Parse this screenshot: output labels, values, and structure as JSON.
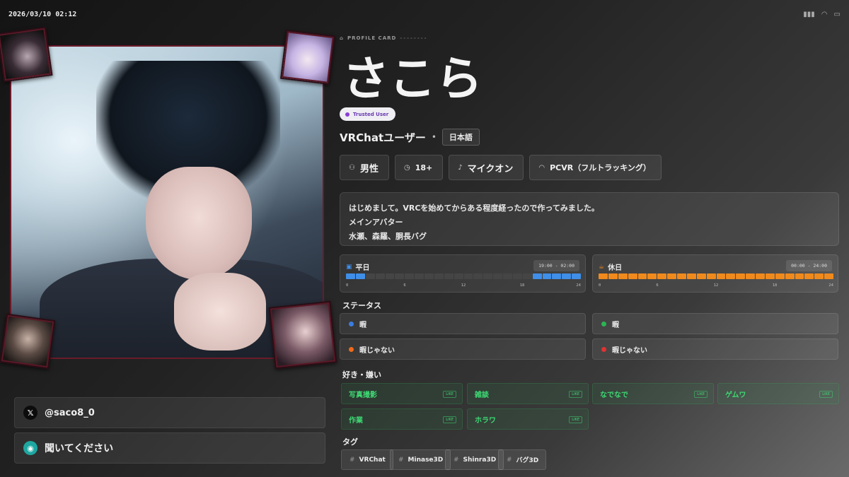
{
  "status_bar": {
    "clock": "2026/03/10 02:12",
    "icons": [
      "signal-icon",
      "wifi-icon",
      "battery-icon"
    ]
  },
  "profile": {
    "eyebrow": "PROFILE CARD",
    "eyebrow_dash": "--------",
    "name": "さこら",
    "trust_badge": "Trusted User",
    "trust_color": "#8a3fd6",
    "subtitle": "VRChatユーザー",
    "language": "日本語"
  },
  "attributes": [
    {
      "icon": "person-icon",
      "label": "男性"
    },
    {
      "icon": "age-icon",
      "label": "18+"
    },
    {
      "icon": "mic-icon",
      "label": "マイクオン"
    },
    {
      "icon": "headset-icon",
      "label": "PCVR（フルトラッキング）"
    }
  ],
  "bio": {
    "lines": [
      "はじめまして。VRCを始めてからある程度経ったので作ってみました。",
      "メインアバター",
      "水瀬、森羅、胴長バグ"
    ]
  },
  "schedule": {
    "weekday": {
      "label": "平日",
      "time": "19:00 - 02:00",
      "color": "#3f8ee8",
      "active_hours": [
        0,
        1,
        19,
        20,
        21,
        22,
        23
      ]
    },
    "holiday": {
      "label": "休日",
      "time": "00:00 - 24:00",
      "color": "#f08a1c",
      "active_hours": [
        0,
        1,
        2,
        3,
        4,
        5,
        6,
        7,
        8,
        9,
        10,
        11,
        12,
        13,
        14,
        15,
        16,
        17,
        18,
        19,
        20,
        21,
        22,
        23
      ]
    },
    "ticks": [
      "0",
      "6",
      "12",
      "18",
      "24"
    ]
  },
  "sections": {
    "status": "ステータス",
    "likes": "好き・嫌い",
    "tags": "タグ"
  },
  "statuses": [
    {
      "label": "暇",
      "color": "#3a7de0"
    },
    {
      "label": "暇",
      "color": "#2bb553"
    },
    {
      "label": "暇じゃない",
      "color": "#f06a1a"
    },
    {
      "label": "暇じゃない",
      "color": "#e03232"
    }
  ],
  "likes": [
    {
      "label": "写真撮影",
      "badge": "LIKE"
    },
    {
      "label": "雑談",
      "badge": "LIKE"
    },
    {
      "label": "なでなで",
      "badge": "LIKE"
    },
    {
      "label": "ゲムワ",
      "badge": "LIKE"
    },
    {
      "label": "作業",
      "badge": "LIKE"
    },
    {
      "label": "ホラワ",
      "badge": "LIKE"
    }
  ],
  "tags": [
    "VRChat",
    "Minase3D",
    "Shinra3D",
    "バグ3D"
  ],
  "links": {
    "x_handle": "@saco8_0",
    "discord_text": "聞いてください"
  }
}
